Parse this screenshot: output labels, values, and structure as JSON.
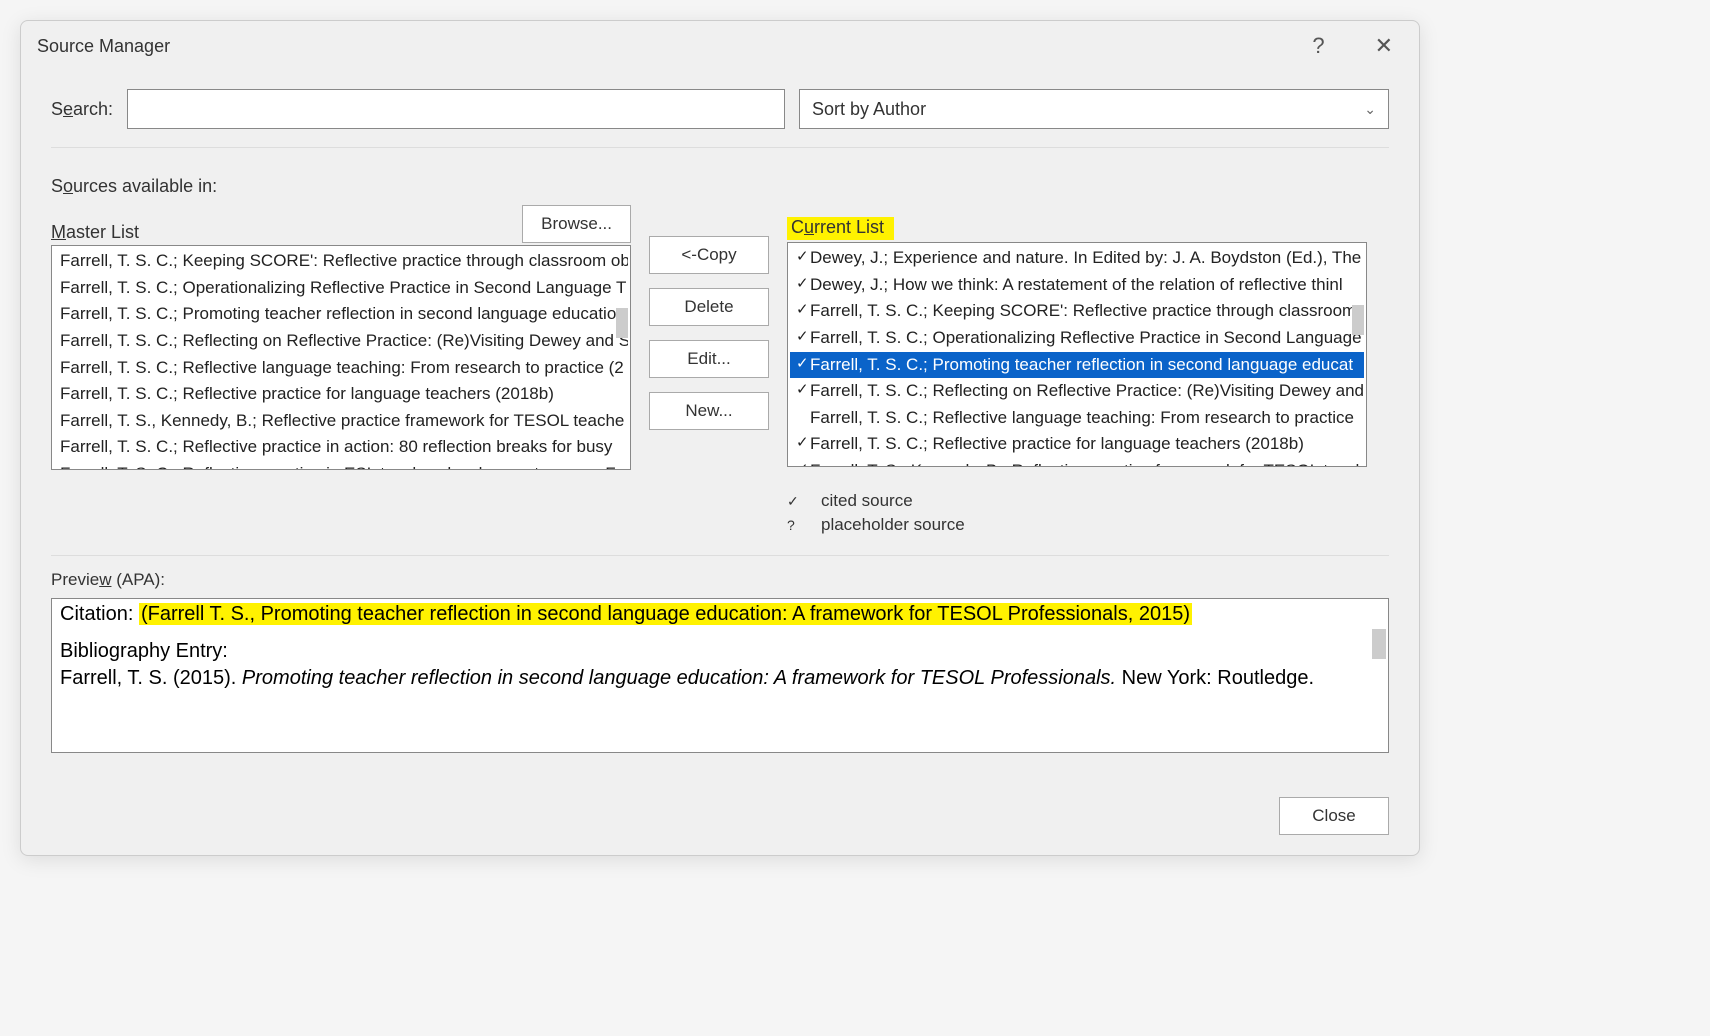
{
  "title": "Source Manager",
  "search": {
    "label_before": "S",
    "label_u": "e",
    "label_after": "arch:",
    "value": ""
  },
  "sort": {
    "selected": "Sort by Author"
  },
  "sources_available": {
    "before": "S",
    "u": "o",
    "after": "urces available in:"
  },
  "master": {
    "label_before": "",
    "label_u": "M",
    "label_after": "aster List"
  },
  "current": {
    "label_before": "C",
    "label_u": "u",
    "label_after": "rrent List"
  },
  "buttons": {
    "browse_before": "",
    "browse_u": "B",
    "browse_after": "rowse...",
    "copy_before": "<- ",
    "copy_u": "C",
    "copy_after": "opy",
    "delete_before": "",
    "delete_u": "D",
    "delete_after": "elete",
    "edit_before": "",
    "edit_u": "E",
    "edit_after": "dit...",
    "new_before": "",
    "new_u": "N",
    "new_after": "ew...",
    "close": "Close"
  },
  "master_list": [
    "Farrell, T. S. C.; Keeping SCORE': Reflective practice through classroom ob",
    "Farrell, T. S. C.; Operationalizing Reflective Practice in Second Language T",
    "Farrell, T. S. C.; Promoting teacher reflection in second language educatio",
    "Farrell, T. S. C.; Reflecting on Reflective Practice: (Re)Visiting Dewey and S",
    "Farrell, T. S. C.; Reflective language teaching: From research to practice (2",
    "Farrell, T. S. C.; Reflective practice for language teachers (2018b)",
    "Farrell, T. S., Kennedy, B.; Reflective practice framework for TESOL teache",
    "Farrell, T. S. C.; Reflective practice in action: 80 reflection breaks for busy",
    "Farrell, T. S. C.; Reflective practice in ESL teacher development groups: Fr"
  ],
  "current_list": [
    {
      "mark": "✓",
      "text": "Dewey, J.; Experience and nature. In Edited by: J. A. Boydston (Ed.), The",
      "selected": false
    },
    {
      "mark": "✓",
      "text": "Dewey, J.; How we think: A restatement of the relation of reflective thinl",
      "selected": false
    },
    {
      "mark": "✓",
      "text": "Farrell, T. S. C.; Keeping SCORE': Reflective practice through classroom o",
      "selected": false
    },
    {
      "mark": "✓",
      "text": "Farrell, T. S. C.; Operationalizing Reflective Practice in Second Language",
      "selected": false
    },
    {
      "mark": "✓",
      "text": "Farrell, T. S. C.; Promoting teacher reflection in second language educat",
      "selected": true
    },
    {
      "mark": "✓",
      "text": "Farrell, T. S. C.; Reflecting on Reflective Practice: (Re)Visiting Dewey and",
      "selected": false
    },
    {
      "mark": "",
      "text": "Farrell, T. S. C.; Reflective language teaching: From research to practice",
      "selected": false
    },
    {
      "mark": "✓",
      "text": "Farrell, T. S. C.; Reflective practice for language teachers (2018b)",
      "selected": false
    },
    {
      "mark": "✓",
      "text": "Farrell, T. S., Kennedy, B.; Reflective practice framework for TESOL teach",
      "selected": false
    }
  ],
  "legend": {
    "cited_mark": "✓",
    "cited_label": "cited source",
    "placeholder_mark": "?",
    "placeholder_label": "placeholder source"
  },
  "preview": {
    "label_before": "Previe",
    "label_u": "w",
    "label_after": " (APA):",
    "citation_label": "Citation:  ",
    "citation_text": "(Farrell T. S., Promoting teacher reflection in second language education: A framework for TESOL Professionals, 2015)",
    "biblio_label": "Bibliography Entry:",
    "biblio_author": "Farrell, T. S. (2015). ",
    "biblio_title": "Promoting teacher reflection in second language education: A framework for TESOL Professionals.",
    "biblio_pub": " New York: Routledge."
  }
}
